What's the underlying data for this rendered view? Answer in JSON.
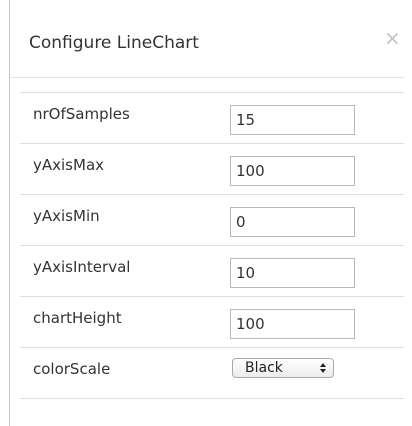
{
  "dialog": {
    "title": "Configure LineChart",
    "close_glyph": "×"
  },
  "fields": [
    {
      "label": "nrOfSamples",
      "value": "15"
    },
    {
      "label": "yAxisMax",
      "value": "100"
    },
    {
      "label": "yAxisMin",
      "value": "0"
    },
    {
      "label": "yAxisInterval",
      "value": "10"
    },
    {
      "label": "chartHeight",
      "value": "100"
    }
  ],
  "color_scale": {
    "label": "colorScale",
    "selected": "Black"
  }
}
